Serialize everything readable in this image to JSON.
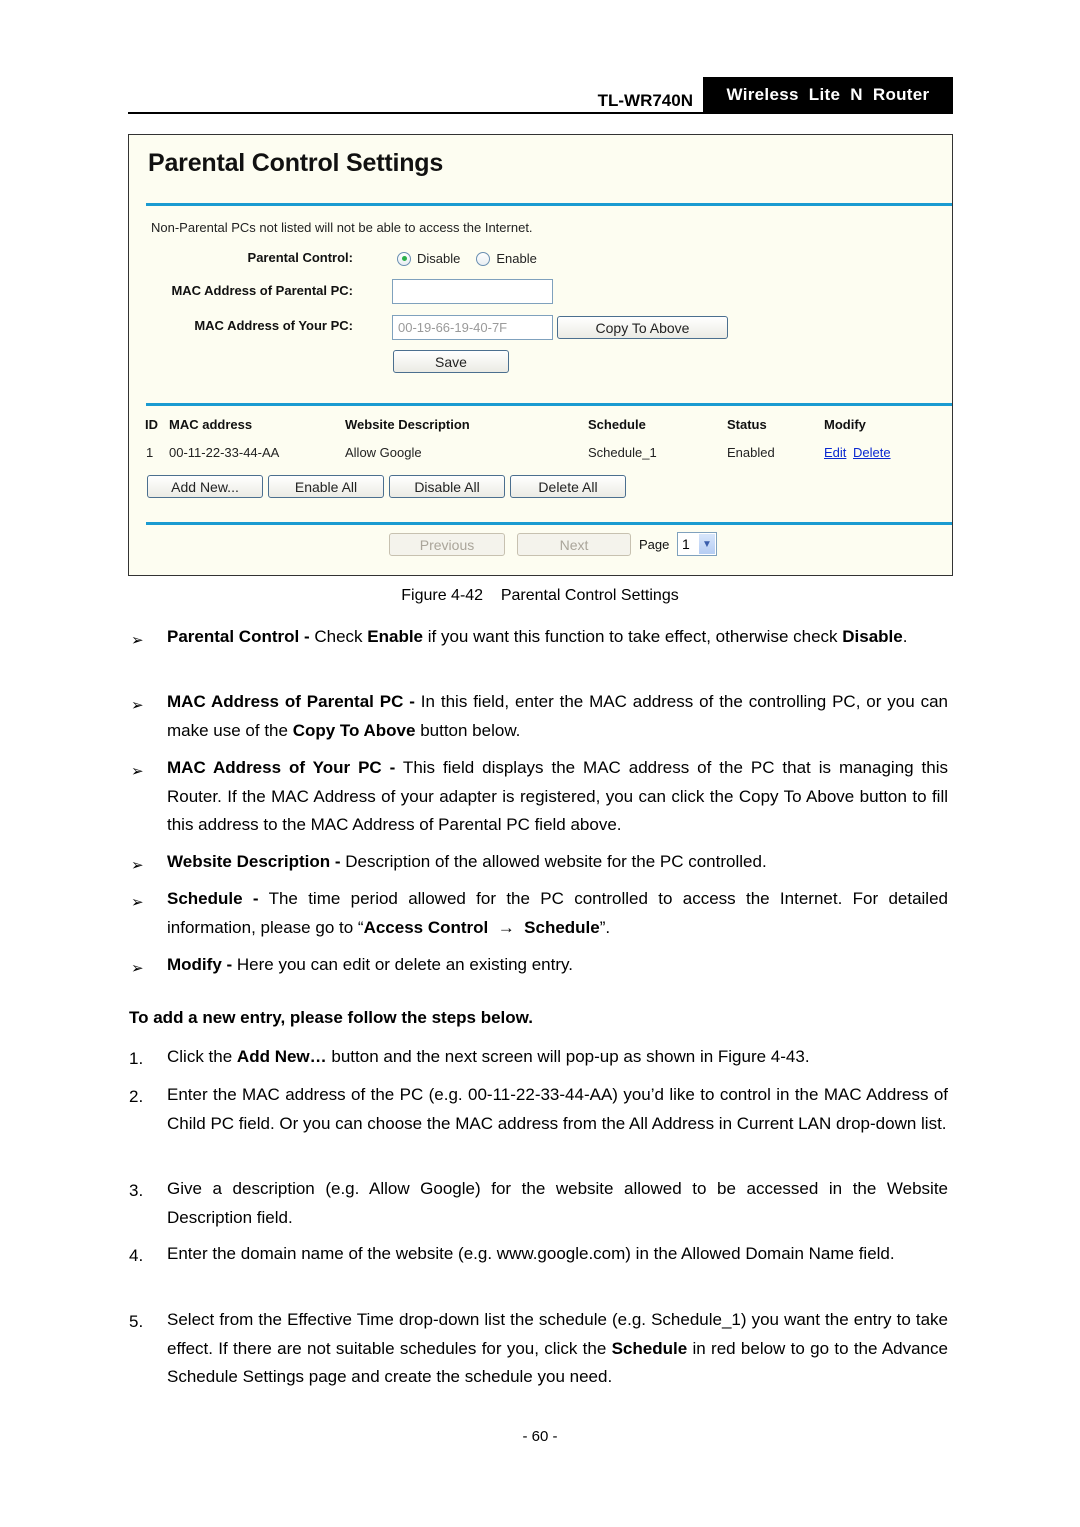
{
  "header": {
    "model": "TL-WR740N",
    "product": "Wireless  Lite  N  Router"
  },
  "figure": {
    "title": "Parental Control Settings",
    "note": "Non-Parental PCs not listed will not be able to access the Internet.",
    "parental_control": {
      "label": "Parental Control:",
      "options": [
        "Disable",
        "Enable"
      ],
      "selected": "Disable"
    },
    "mac_parental": {
      "label": "MAC Address of Parental PC:",
      "value": ""
    },
    "mac_your": {
      "label": "MAC Address of Your PC:",
      "value": "00-19-66-19-40-7F"
    },
    "copy_button": "Copy To Above",
    "save_button": "Save",
    "table": {
      "headers": [
        "ID",
        "MAC address",
        "Website Description",
        "Schedule",
        "Status",
        "Modify"
      ],
      "rows": [
        {
          "id": "1",
          "mac": "00-11-22-33-44-AA",
          "description": "Allow Google",
          "schedule": "Schedule_1",
          "status": "Enabled",
          "edit": "Edit",
          "delete": "Delete"
        }
      ]
    },
    "actions": {
      "add_new": "Add New...",
      "enable_all": "Enable All",
      "disable_all": "Disable All",
      "delete_all": "Delete All"
    },
    "pager": {
      "previous": "Previous",
      "next": "Next",
      "page_label": "Page",
      "page_value": "1"
    },
    "colors": {
      "rule": "#1a9bd1",
      "panel_bg": "#fdfdf1",
      "link": "#0a28d0"
    }
  },
  "caption": "Figure 4-42    Parental Control Settings",
  "bullets": [
    {
      "term": "Parental Control -",
      "parts": [
        " Check ",
        "Enable",
        " if you want this function to take effect, otherwise check ",
        "Disable",
        "."
      ]
    },
    {
      "term": "MAC Address of Parental PC -",
      "parts": [
        " In this field, enter the MAC address of the controlling PC, or you can make use of the ",
        "Copy To Above",
        " button below."
      ]
    },
    {
      "term": "MAC Address of Your PC -",
      "text": " This field displays the MAC address of the PC that is managing this Router. If the MAC Address of your adapter is registered, you can click the Copy To Above button to fill this address to the MAC Address of Parental PC field above."
    },
    {
      "term": "Website Description -",
      "text": " Description of the allowed website for the PC controlled."
    },
    {
      "term": "Schedule -",
      "parts": [
        " The time period allowed for the PC controlled to access the Internet. For detailed information, please go to “",
        "Access Control  →  Schedule",
        "”."
      ]
    },
    {
      "term": "Modify -",
      "text": " Here you can edit or delete an existing entry."
    }
  ],
  "steps_heading": "To add a new entry, please follow the steps below.",
  "steps": [
    {
      "n": "1.",
      "parts": [
        "Click the ",
        "Add New…",
        " button and the next screen will pop-up as shown in Figure 4-43."
      ]
    },
    {
      "n": "2.",
      "text": "Enter the MAC address of the PC (e.g. 00-11-22-33-44-AA) you’d like to control in the MAC Address of Child PC field. Or you can choose the MAC address from the All Address in Current LAN drop-down list."
    },
    {
      "n": "3.",
      "text": "Give a description (e.g. Allow Google) for the website allowed to be accessed in the Website Description field."
    },
    {
      "n": "4.",
      "text": "Enter the domain name of the website (e.g. www.google.com) in the Allowed Domain Name field."
    },
    {
      "n": "5.",
      "parts": [
        "Select from the Effective Time drop-down list the schedule (e.g. Schedule_1) you want the entry to take effect. If there are not suitable schedules for you, click the ",
        "Schedule",
        " in red below to go to the Advance Schedule Settings page and create the schedule you need."
      ]
    }
  ],
  "bullet_glyph": "➢",
  "page_number": "- 60 -"
}
